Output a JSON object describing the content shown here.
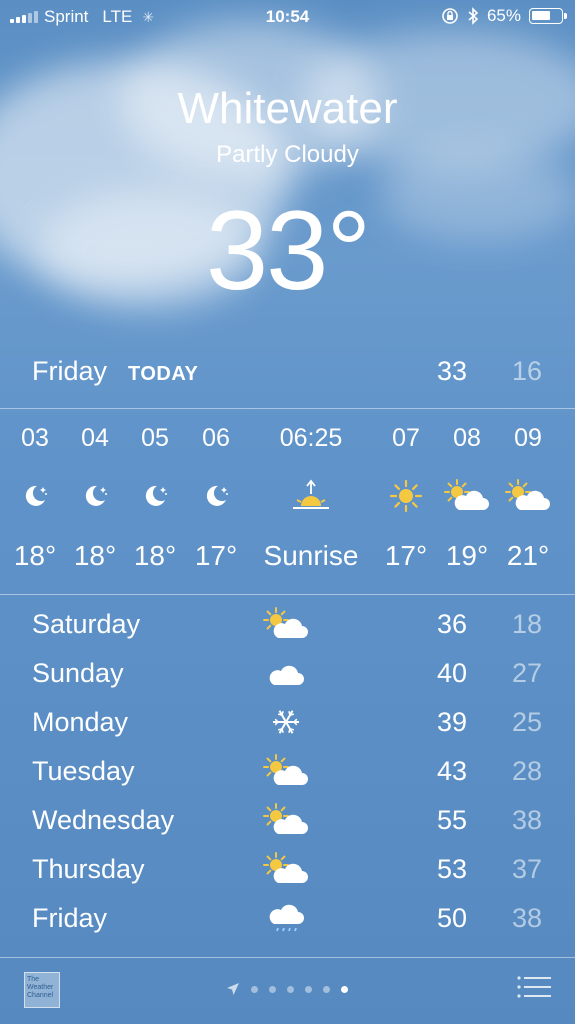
{
  "status_bar": {
    "carrier": "Sprint",
    "network": "LTE",
    "time": "10:54",
    "battery": "65%",
    "battery_level": 0.65
  },
  "location": {
    "city": "Whitewater",
    "condition": "Partly Cloudy",
    "temperature": "33°"
  },
  "today": {
    "day": "Friday",
    "tag": "TODAY",
    "high": "33",
    "low": "16"
  },
  "hourly": [
    {
      "hour": "03",
      "icon": "moon-stars-icon",
      "temp": "18°"
    },
    {
      "hour": "04",
      "icon": "moon-stars-icon",
      "temp": "18°"
    },
    {
      "hour": "05",
      "icon": "moon-stars-icon",
      "temp": "18°"
    },
    {
      "hour": "06",
      "icon": "moon-stars-icon",
      "temp": "17°"
    },
    {
      "hour": "06:25",
      "icon": "sunrise-icon",
      "temp": "Sunrise"
    },
    {
      "hour": "07",
      "icon": "sun-icon",
      "temp": "17°"
    },
    {
      "hour": "08",
      "icon": "partly-cloudy-icon",
      "temp": "19°"
    },
    {
      "hour": "09",
      "icon": "partly-cloudy-icon",
      "temp": "21°"
    }
  ],
  "daily": [
    {
      "day": "Saturday",
      "icon": "partly-cloudy-icon",
      "high": "36",
      "low": "18"
    },
    {
      "day": "Sunday",
      "icon": "cloud-icon",
      "high": "40",
      "low": "27"
    },
    {
      "day": "Monday",
      "icon": "snowflake-icon",
      "high": "39",
      "low": "25"
    },
    {
      "day": "Tuesday",
      "icon": "partly-cloudy-icon",
      "high": "43",
      "low": "28"
    },
    {
      "day": "Wednesday",
      "icon": "partly-cloudy-icon",
      "high": "55",
      "low": "38"
    },
    {
      "day": "Thursday",
      "icon": "partly-cloudy-icon",
      "high": "53",
      "low": "37"
    },
    {
      "day": "Friday",
      "icon": "rain-cloud-icon",
      "high": "50",
      "low": "38"
    }
  ],
  "footer": {
    "logo_text": "The Weather Channel",
    "page_count": 6,
    "active_page": 6
  },
  "colors": {
    "sky": "#5f93c9",
    "sun": "#f5c842",
    "low_temp": "rgba(255,255,255,0.55)"
  }
}
